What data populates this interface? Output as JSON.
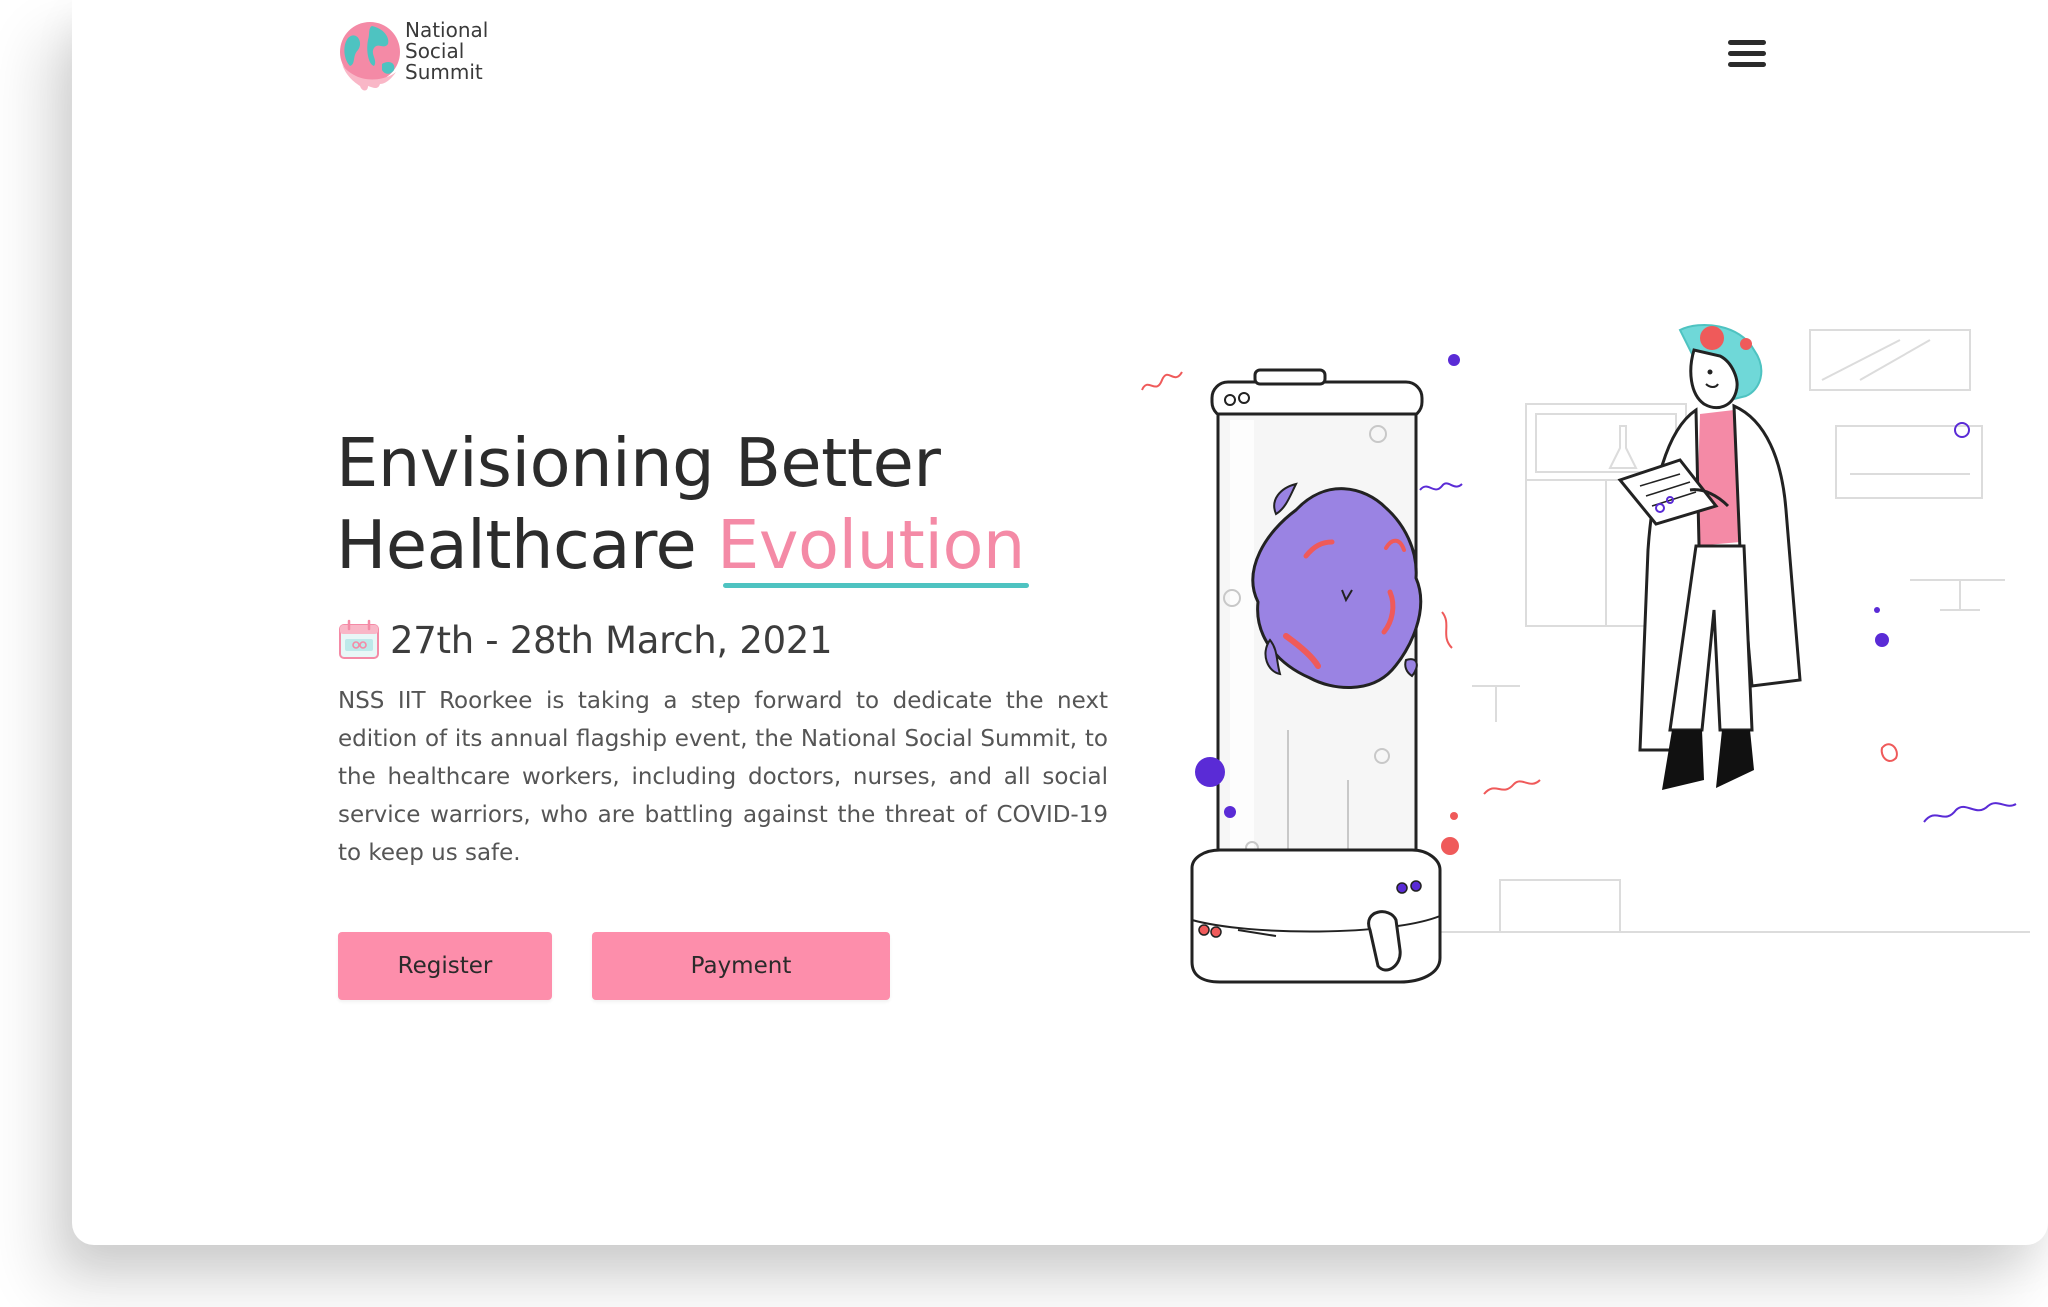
{
  "brand": {
    "logo_icon": "globe-logo-icon",
    "name_lines": [
      "National",
      "Social",
      "Summit"
    ]
  },
  "nav": {
    "menu_icon": "hamburger-menu-icon"
  },
  "hero": {
    "title_line1": "Envisioning Better",
    "title_line2_plain": "Healthcare ",
    "title_line2_accent": "Evolution",
    "date_icon": "calendar-icon",
    "date_text": "27th - 28th March, 2021",
    "description": "NSS IIT Roorkee is taking a step forward to dedicate the next edition of its annual flagship event, the National Social Summit,  to the healthcare workers, including doctors, nurses, and all social  service warriors, who are battling against the threat of COVID-19 to  keep us safe.",
    "register_label": "Register",
    "payment_label": "Payment"
  },
  "illustration": {
    "name": "doctor-virus-lab-illustration"
  },
  "colors": {
    "accent_pink": "#f48aa6",
    "button_pink": "#fd8eab",
    "underline_teal": "#4ec3c1",
    "virus_purple": "#9a83e3",
    "dot_indigo": "#5a2bd6",
    "dot_red": "#ef5a5a"
  }
}
